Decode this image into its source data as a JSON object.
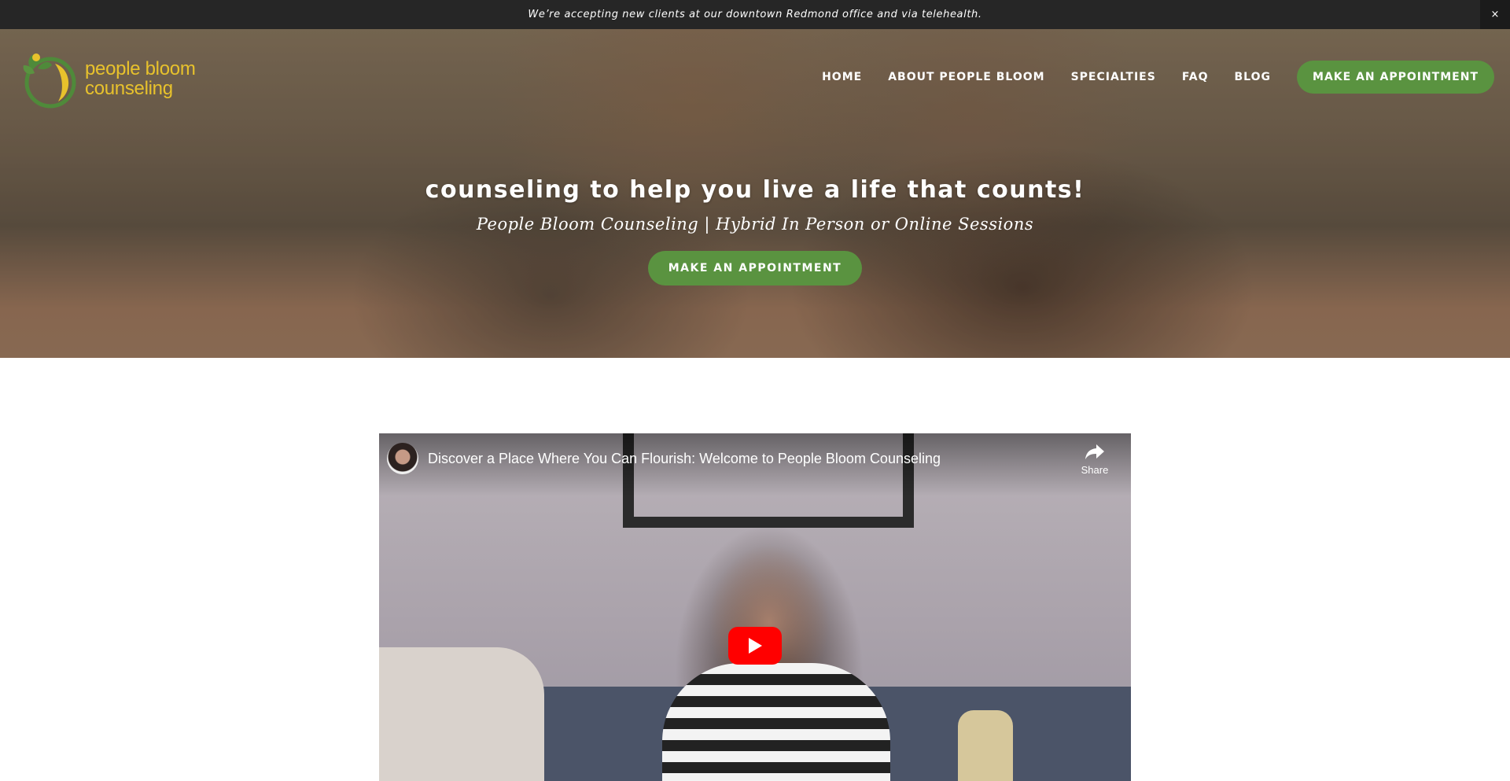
{
  "announcement": {
    "text": "We’re accepting new clients at our downtown Redmond office and via telehealth.",
    "close_label": "×"
  },
  "logo": {
    "line1": "people bloom",
    "line2": "counseling",
    "color": "#e8c22c",
    "leaf_color": "#4f8a3a"
  },
  "nav": {
    "items": [
      {
        "label": "HOME"
      },
      {
        "label": "ABOUT PEOPLE BLOOM"
      },
      {
        "label": "SPECIALTIES"
      },
      {
        "label": "FAQ"
      },
      {
        "label": "BLOG"
      }
    ],
    "cta_label": "MAKE AN APPOINTMENT"
  },
  "hero": {
    "title": "counseling to help you live a life that counts!",
    "subtitle": "People Bloom Counseling | Hybrid In Person or Online Sessions",
    "cta_label": "MAKE AN APPOINTMENT"
  },
  "video": {
    "title": "Discover a Place Where You Can Flourish: Welcome to People Bloom Counseling",
    "share_label": "Share",
    "share_icon": "share-arrow-icon",
    "play_icon": "youtube-play-icon"
  },
  "colors": {
    "accent_green": "#5a9340",
    "announcement_bg": "#262626",
    "play_red": "#ff0000"
  }
}
